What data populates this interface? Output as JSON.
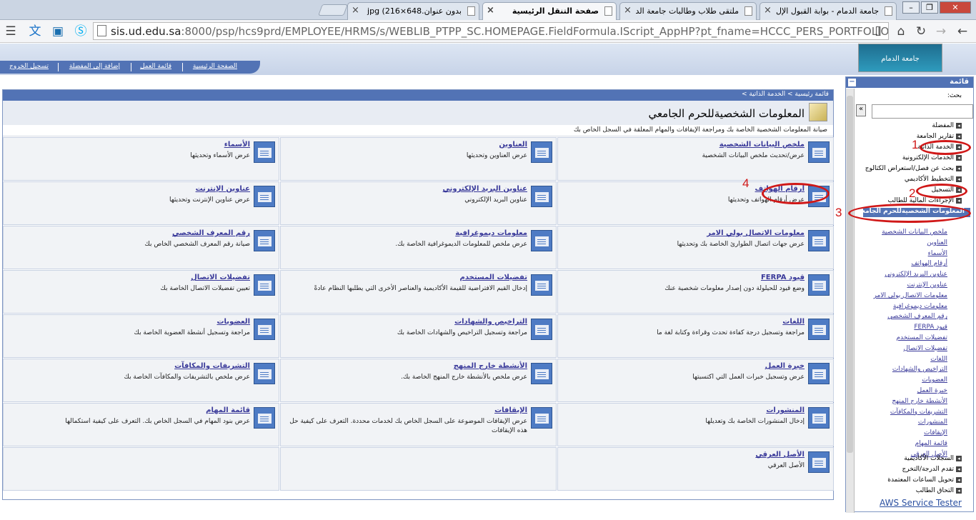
{
  "browser": {
    "tabs": [
      {
        "label": "جامعة الدمام - بوابة القبول الإل"
      },
      {
        "label": "ملتقى طلاب وطالبات جامعة الد"
      },
      {
        "label": "صفحة التنقل الرئيسية"
      },
      {
        "label": "بدون عنوان.648×216) jpg"
      }
    ],
    "url_prefix": "sis.ud.edu.sa",
    "url_rest": ":8000/psp/hcs9prd/EMPLOYEE/HRMS/s/WEBLIB_PTPP_SC.HOMEPAGE.FieldFormula.IScript_AppHP?pt_fname=HCCC_PERS_PORTFOLIO&Fol"
  },
  "header": {
    "logo": "جامعة الدمام",
    "nav": [
      "الصفحة الرئيسية",
      "قائمة العمل",
      "إضافة إلى المفضلة",
      "تسجيل الخروج"
    ]
  },
  "main": {
    "breadcrumb": "قائمة رئيسية > الخدمة الذاتية >",
    "title": "المعلومات الشخصيةللحرم الجامعي",
    "description": "صيانة المعلومات الشخصية الخاصة بك ومراجعة الإيقافات والمهام المعلقة في السجل الخاص بك",
    "items": [
      {
        "title": "ملخص البيانات الشخصية",
        "desc": "عرض/تحديث ملخص البيانات الشخصية"
      },
      {
        "title": "العناوين",
        "desc": "عرض العناوين وتحديثها"
      },
      {
        "title": "الأسماء",
        "desc": "عرض الأسماء وتحديثها"
      },
      {
        "title": "أرقام الهواتف",
        "desc": "عرض أرقام الهواتف وتحديثها"
      },
      {
        "title": "عناوين البريد الإلكتروني",
        "desc": "عناوين البريد الإلكتروني"
      },
      {
        "title": "عناوين الإنترنت",
        "desc": "عرض عناوين الإنترنت وتحديثها"
      },
      {
        "title": "معلومات الاتصال بولي الامر",
        "desc": "عرض جهات اتصال الطوارئ الخاصة بك وتحديثها"
      },
      {
        "title": "معلومات ديموغرافية",
        "desc": "عرض ملخص للمعلومات الديموغرافية الخاصة بك."
      },
      {
        "title": "رقم المعرف الشخصي",
        "desc": "صيانة رقم المعرف الشخصي الخاص بك"
      },
      {
        "title": "قيود FERPA",
        "desc": "وضع قيود للحيلولة دون إصدار معلومات شخصية عنك"
      },
      {
        "title": "تفضيلات المستخدم",
        "desc": "إدخال القيم الافتراضية للقيمة الأكاديمية والعناصر الأخرى التي يطلبها النظام عادةً"
      },
      {
        "title": "تفضيلات الاتصال",
        "desc": "تعيين تفضيلات الاتصال الخاصة بك"
      },
      {
        "title": "اللغات",
        "desc": "مراجعة وتسجيل درجة كفاءة تحدث وقراءة وكتابة لغة ما"
      },
      {
        "title": "التراخيص والشهادات",
        "desc": "مراجعة وتسجيل التراخيص والشهادات الخاصة بك"
      },
      {
        "title": "العضويات",
        "desc": "مراجعة وتسجيل أنشطة العضوية الخاصة بك"
      },
      {
        "title": "خبرة العمل",
        "desc": "عرض وتسجيل خبرات العمل التي اكتسبتها"
      },
      {
        "title": "الأنشطة خارج المنهج",
        "desc": "عرض ملخص بالأنشطة خارج المنهج الخاصة بك."
      },
      {
        "title": "التشريفات والمكافآت",
        "desc": "عرض ملخص بالتشريفات والمكافآت الخاصة بك"
      },
      {
        "title": "المنشورات",
        "desc": "إدخال المنشورات الخاصة بك وتعديلها"
      },
      {
        "title": "الإيقافات",
        "desc": "عرض الإيقافات الموضوعة على السجل الخاص بك لخدمات محددة. التعرف على كيفية حل هذه الإيقافات"
      },
      {
        "title": "قائمة المهام",
        "desc": "عرض بنود المهام في السجل الخاص بك. التعرف على كيفية استكمالها"
      },
      {
        "title": "الأصل العرقي",
        "desc": "الأصل العرقي"
      }
    ]
  },
  "menu": {
    "title": "قائمة",
    "search_label": "بحث:",
    "top_items": [
      "المفضلة",
      "تقارير الجامعة",
      "الخدمة الذاتية",
      "الخدمات الإلكترونية",
      "بحث عن فصل/استعراض الكتالوج",
      "التخطيط الأكاديمي",
      "التسجيل",
      "الإجراءات المالية للطالب",
      "المعلومات الشخصيةللحرم الجامعي"
    ],
    "sub_items": [
      "ملخص البيانات الشخصية",
      "العناوين",
      "الأسماء",
      "أرقام الهواتف",
      "عناوين البريد الإلكتروني",
      "عناوين الإنترنت",
      "معلومات الاتصال بولي الامر",
      "معلومات ديموغرافية",
      "رقم المعرف الشخصي",
      "قيود FERPA",
      "تفضيلات المستخدم",
      "تفضيلات الاتصال",
      "اللغات",
      "التراخيص والشهادات",
      "العضويات",
      "خبرة العمل",
      "الأنشطة خارج المنهج",
      "التشريفات والمكافآت",
      "المنشورات",
      "الإيقافات",
      "قائمة المهام",
      "الأصل العرقي"
    ],
    "bottom_items": [
      "السجلات الأكاديمية",
      "تقدم الدرجة/التخرج",
      "تحويل الساعات المعتمدة",
      "التحاق الطالب"
    ],
    "footer_link": "AWS Service Tester"
  },
  "annotations": [
    "1",
    "2",
    "3",
    "4"
  ],
  "colors": {
    "accent": "#5273b5",
    "annotation": "#d01818"
  }
}
